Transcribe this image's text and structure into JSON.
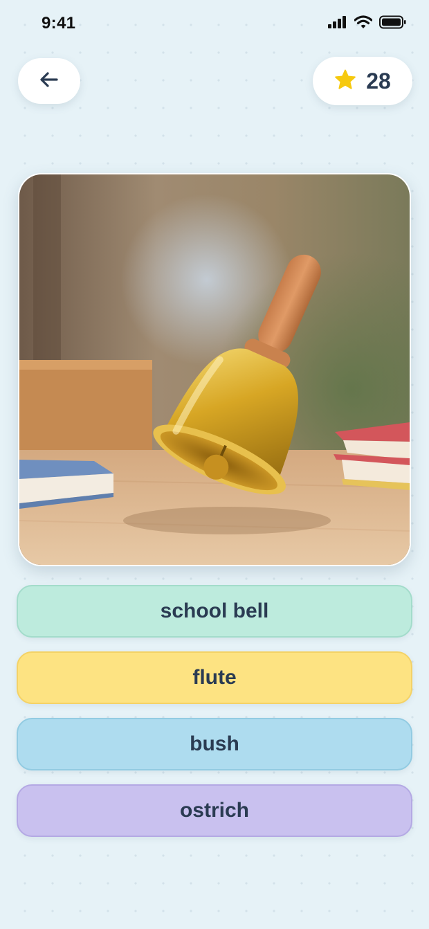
{
  "status_bar": {
    "time": "9:41",
    "icons": [
      "cellular-signal-icon",
      "wifi-icon",
      "battery-icon"
    ]
  },
  "header": {
    "back_icon": "arrow-left-icon",
    "score_icon": "star-icon",
    "score": "28"
  },
  "question": {
    "image_subject": "golden hand bell on a desk with books"
  },
  "answers": [
    {
      "label": "school bell",
      "color": "#bdebdd"
    },
    {
      "label": "flute",
      "color": "#fde382"
    },
    {
      "label": "bush",
      "color": "#aedcef"
    },
    {
      "label": "ostrich",
      "color": "#c9c1ef"
    }
  ],
  "colors": {
    "background": "#e6f2f7",
    "text": "#2a3b52",
    "star": "#f6c90e"
  }
}
